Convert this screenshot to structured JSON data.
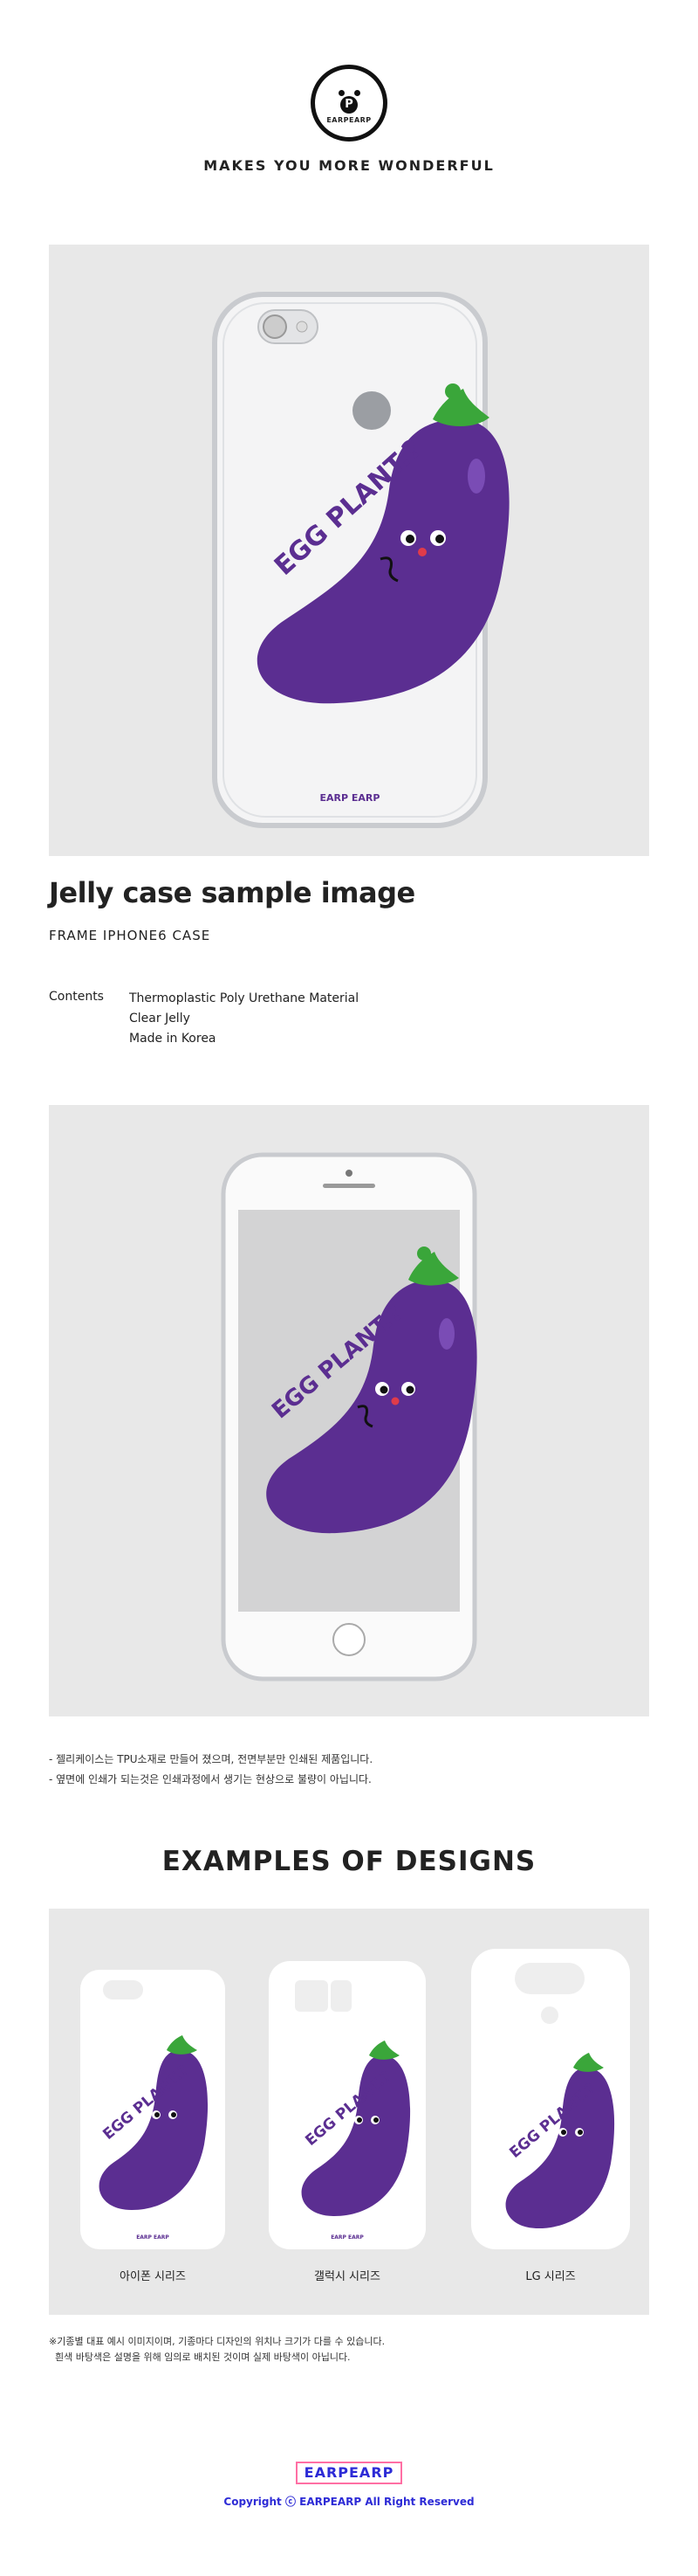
{
  "header": {
    "logo_letter": "P",
    "logo_text": "EARPEARP",
    "tagline": "MAKES YOU MORE WONDERFUL"
  },
  "product": {
    "title": "Jelly case sample image",
    "subtitle": "FRAME IPHONE6 CASE",
    "contents_label": "Contents",
    "contents": [
      "Thermoplastic Poly Urethane Material",
      "Clear Jelly",
      "Made in Korea"
    ],
    "artwork_text": "EGG PLANT.?",
    "case_brand": "EARP EARP"
  },
  "notes": [
    "- 젤리케이스는 TPU소재로 만들어 졌으며, 전면부분만 인쇄된 제품입니다.",
    "- 옆면에 인쇄가 되는것은 인쇄과정에서 생기는 현상으로 불량이 아닙니다."
  ],
  "examples": {
    "heading": "EXAMPLES OF DESIGNS",
    "items": [
      {
        "label": "아이폰 시리즈"
      },
      {
        "label": "갤럭시 시리즈"
      },
      {
        "label": "LG 시리즈"
      }
    ]
  },
  "footnotes": [
    "※기종별 대표 예시 이미지이며, 기종마다 디자인의 위치나 크기가 다를 수 있습니다.",
    "  흰색 바탕색은 설명을 위해 임의로 배치된 것이며 실제 바탕색이 아닙니다."
  ],
  "footer": {
    "brand": "EARPEARP",
    "copyright": "Copyright ⓒ EARPEARP All Right Reserved"
  },
  "colors": {
    "eggplant": "#5b2e91",
    "stem": "#3aa63a",
    "brand_blue": "#2d2bd6",
    "brand_pink": "#ff6fa4",
    "panel": "#e8e8e8"
  }
}
